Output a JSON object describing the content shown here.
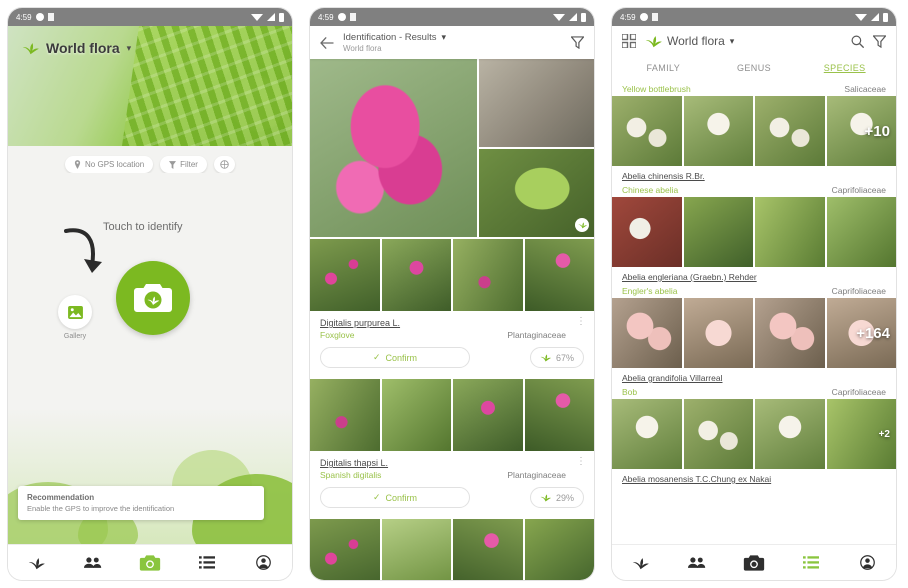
{
  "status_bar": {
    "time": "4:59"
  },
  "screen1": {
    "app_title": "World flora",
    "chips": [
      {
        "icon": "location-pin-icon",
        "label": "No GPS location"
      },
      {
        "icon": "filter-icon",
        "label": "Filter"
      },
      {
        "icon": "globe-icon",
        "label": ""
      }
    ],
    "touch_hint": "Touch to identify",
    "camera_button_label": "camera-shutter",
    "gallery_label": "Gallery",
    "recommendation": {
      "title": "Recommendation",
      "subtitle": "Enable the GPS to improve the identification"
    },
    "nav": [
      {
        "name": "plant",
        "label": "Plants"
      },
      {
        "name": "community",
        "label": "Community"
      },
      {
        "name": "camera",
        "label": "Identify"
      },
      {
        "name": "list",
        "label": "Explore"
      },
      {
        "name": "profile",
        "label": "Profile"
      }
    ],
    "nav_active": "camera"
  },
  "screen2": {
    "title": "Identification - Results",
    "subtitle": "World flora",
    "back_icon": "back-arrow-icon",
    "filter_icon": "filter-icon",
    "results": [
      {
        "scientific_name": "Digitalis purpurea L.",
        "common_name": "Foxglove",
        "family": "Plantaginaceae",
        "confirm_label": "Confirm",
        "score": "67%"
      },
      {
        "scientific_name": "Digitalis thapsi L.",
        "common_name": "Spanish digitalis",
        "family": "Plantaginaceae",
        "confirm_label": "Confirm",
        "score": "29%"
      }
    ]
  },
  "screen3": {
    "app_title": "World flora",
    "grid_icon": "grid-view-icon",
    "search_icon": "search-icon",
    "filter_icon": "filter-icon",
    "tabs": [
      {
        "label": "FAMILY",
        "active": false
      },
      {
        "label": "GENUS",
        "active": false
      },
      {
        "label": "SPECIES",
        "active": true
      }
    ],
    "top_entry": {
      "common_name": "Yellow bottlebrush",
      "family": "Salicaceae"
    },
    "species": [
      {
        "scientific_name": "Abelia chinensis R.Br.",
        "common_name": "Chinese abelia",
        "family": "Caprifoliaceae",
        "more_count": "+10"
      },
      {
        "scientific_name": "Abelia engleriana (Graebn.) Rehder",
        "common_name": "Engler's abelia",
        "family": "Caprifoliaceae",
        "more_count": ""
      },
      {
        "scientific_name": "Abelia grandifolia Villarreal",
        "common_name": "Bob",
        "family": "Caprifoliaceae",
        "more_count": "+164"
      },
      {
        "scientific_name": "Abelia mosanensis T.C.Chung ex Nakai",
        "common_name": "",
        "family": "",
        "more_count": "+2"
      }
    ],
    "nav_active": "list"
  },
  "colors": {
    "brand_green": "#7cb921",
    "accent_green": "#9ac24a",
    "status_bar": "#808080",
    "text_primary": "#4b4b4b",
    "text_secondary": "#8a8a8a"
  }
}
